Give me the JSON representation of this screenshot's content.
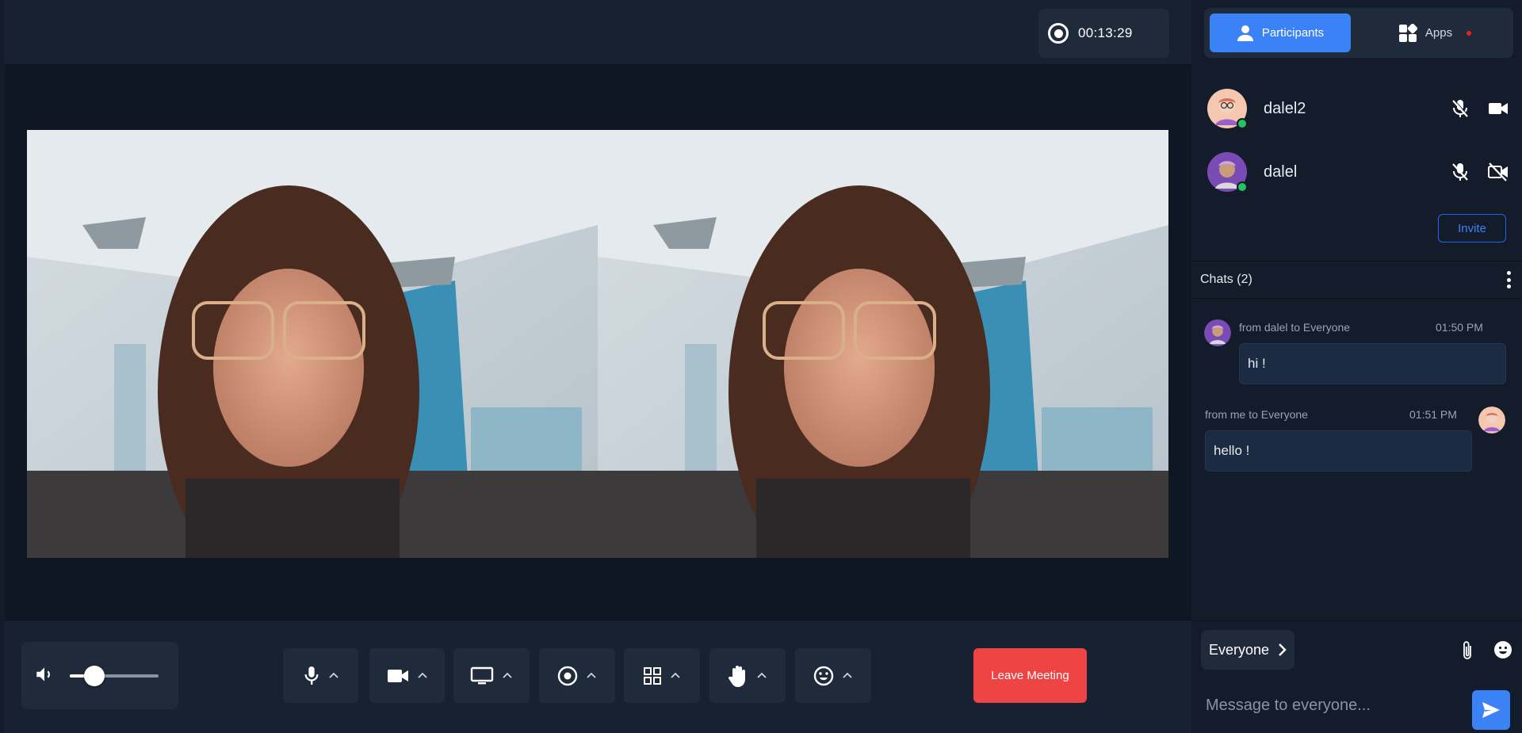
{
  "recording": {
    "time": "00:13:29"
  },
  "controls": {
    "volume_level": 0.28,
    "leave_label": "Leave Meeting"
  },
  "tabs": {
    "participants_label": "Participants",
    "apps_label": "Apps"
  },
  "participants": [
    {
      "name": "dalel2",
      "mic": "muted",
      "camera": "on",
      "avatar_color": "#f4c7ae"
    },
    {
      "name": "dalel",
      "mic": "muted",
      "camera": "off",
      "avatar_color": "#7b4bb5"
    }
  ],
  "invite_label": "Invite",
  "chat": {
    "header": "Chats (2)",
    "messages": [
      {
        "meta": "from dalel to Everyone",
        "time": "01:50 PM",
        "text": "hi !"
      },
      {
        "meta": "from me to Everyone",
        "time": "01:51 PM",
        "text": "hello !"
      }
    ]
  },
  "composer": {
    "recipient": "Everyone",
    "placeholder": "Message to everyone..."
  },
  "colors": {
    "accent": "#3b82f6",
    "danger": "#ef4444",
    "online": "#22c55e"
  }
}
